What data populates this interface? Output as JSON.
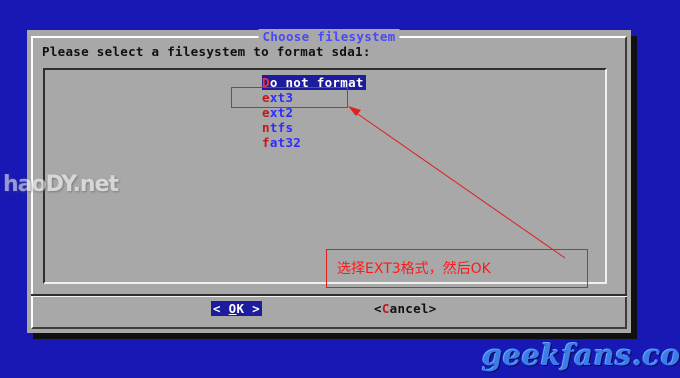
{
  "dialog": {
    "title": "Choose filesystem",
    "prompt": "Please select a filesystem to format sda1:"
  },
  "options": [
    {
      "hotkey": "D",
      "rest": "o not format",
      "selected": true
    },
    {
      "hotkey": "e",
      "rest": "xt3",
      "selected": false
    },
    {
      "hotkey": "e",
      "rest": "xt2",
      "selected": false
    },
    {
      "hotkey": "n",
      "rest": "tfs",
      "selected": false
    },
    {
      "hotkey": "f",
      "rest": "at32",
      "selected": false
    }
  ],
  "buttons": {
    "ok": {
      "prefix": "< ",
      "hotkey": "O",
      "rest": "K",
      "suffix": " >"
    },
    "cancel": {
      "prefix": "<",
      "hotkey": "C",
      "rest": "ancel",
      "suffix": ">"
    }
  },
  "annotation": {
    "note": "选择EXT3格式，然后OK"
  },
  "watermarks": {
    "left": "haoDY.net",
    "right": "geekfans.com"
  },
  "colors": {
    "background": "#1818b4",
    "dialog": "#a8a8a8",
    "selection": "#1c1c9c",
    "item_text": "#2c2cff",
    "hotkey": "#c01818",
    "annotation": "#e02020"
  }
}
